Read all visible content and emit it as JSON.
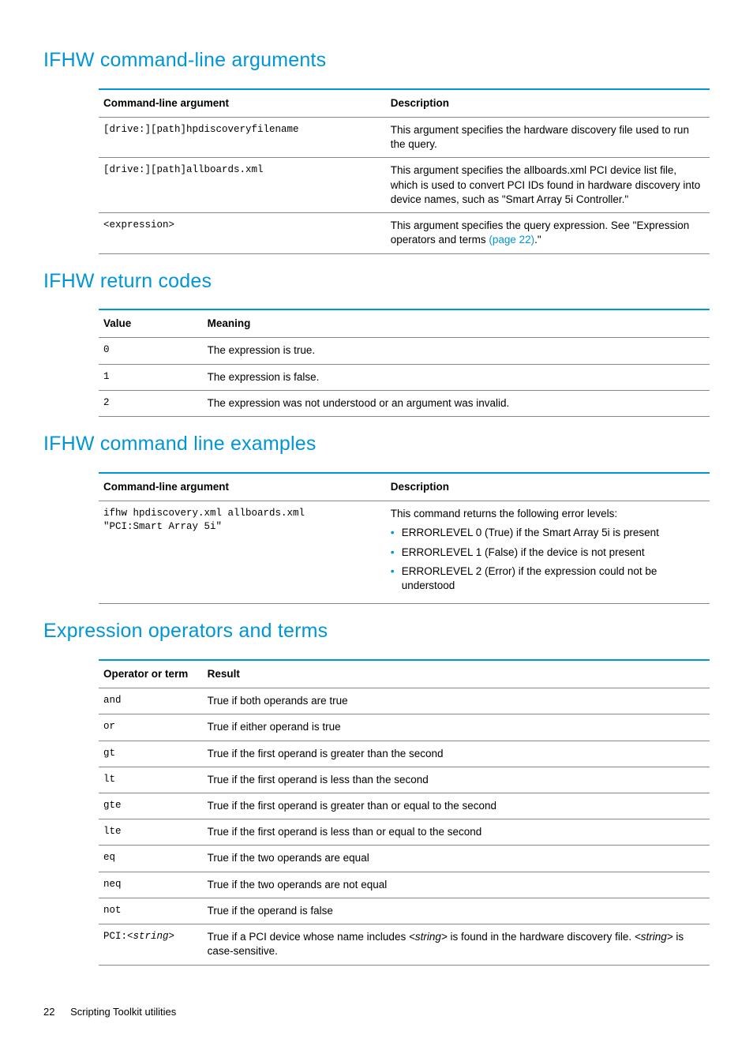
{
  "sections": {
    "args": {
      "title": "IFHW command-line arguments",
      "headers": [
        "Command-line argument",
        "Description"
      ],
      "rows": [
        {
          "arg": "[drive:][path]hpdiscoveryfilename",
          "desc": "This argument specifies the hardware discovery file used to run the query."
        },
        {
          "arg": "[drive:][path]allboards.xml",
          "desc": "This argument specifies the allboards.xml PCI device list file, which is used to convert PCI IDs found in hardware discovery into device names, such as \"Smart Array 5i Controller.\""
        },
        {
          "arg": "<expression>",
          "desc_pre": "This argument specifies the query expression. See \"Expression operators and terms ",
          "desc_link": "(page 22)",
          "desc_post": ".\""
        }
      ]
    },
    "returns": {
      "title": "IFHW return codes",
      "headers": [
        "Value",
        "Meaning"
      ],
      "rows": [
        {
          "val": "0",
          "meaning": "The expression is true."
        },
        {
          "val": "1",
          "meaning": "The expression is false."
        },
        {
          "val": "2",
          "meaning": "The expression was not understood or an argument was invalid."
        }
      ]
    },
    "examples": {
      "title": "IFHW command line examples",
      "headers": [
        "Command-line argument",
        "Description"
      ],
      "arg_line1": "ifhw hpdiscovery.xml allboards.xml",
      "arg_line2": "\"PCI:Smart Array 5i\"",
      "desc_intro": "This command returns the following error levels:",
      "bullets": [
        "ERRORLEVEL 0 (True) if the Smart Array 5i is present",
        "ERRORLEVEL 1 (False) if the device is not present",
        "ERRORLEVEL 2 (Error) if the expression could not be understood"
      ]
    },
    "ops": {
      "title": "Expression operators and terms",
      "headers": [
        "Operator or term",
        "Result"
      ],
      "rows": [
        {
          "op": "and",
          "res": "True if both operands are true"
        },
        {
          "op": "or",
          "res": "True if either operand is true"
        },
        {
          "op": "gt",
          "res": "True if the first operand is greater than the second"
        },
        {
          "op": "lt",
          "res": "True if the first operand is less than the second"
        },
        {
          "op": "gte",
          "res": "True if the first operand is greater than or equal to the second"
        },
        {
          "op": "lte",
          "res": "True if the first operand is less than or equal to the second"
        },
        {
          "op": "eq",
          "res": "True if the two operands are equal"
        },
        {
          "op": "neq",
          "res": "True if the two operands are not equal"
        },
        {
          "op": "not",
          "res": "True if the operand is false"
        }
      ],
      "pci_op_pre": "PCI:",
      "pci_op_str": "<string>",
      "pci_res_1": "True if a PCI device whose name includes ",
      "pci_res_str1": "<string>",
      "pci_res_2": " is found in the hardware discovery file. ",
      "pci_res_str2": "<string>",
      "pci_res_3": " is case-sensitive."
    }
  },
  "footer": {
    "page": "22",
    "title": "Scripting Toolkit utilities"
  }
}
